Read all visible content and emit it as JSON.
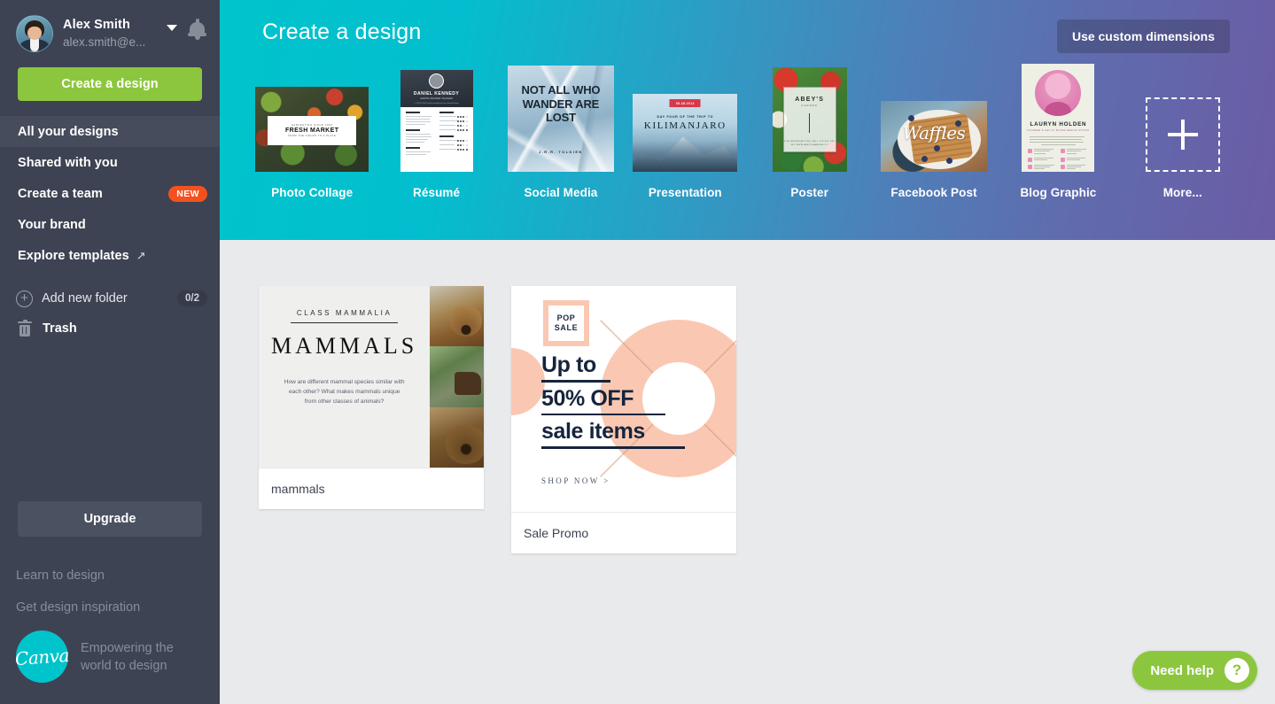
{
  "sidebar": {
    "user": {
      "name": "Alex Smith",
      "email": "alex.smith@e...",
      "avatar_icon": "user-avatar",
      "caret_icon": "chevron-down-icon",
      "bell_icon": "notification-bell-icon"
    },
    "create_button": "Create a design",
    "nav": [
      {
        "label": "All your designs",
        "active": true
      },
      {
        "label": "Shared with you",
        "active": false
      },
      {
        "label": "Create a team",
        "active": false,
        "badge": "NEW"
      },
      {
        "label": "Your brand",
        "active": false
      },
      {
        "label": "Explore templates",
        "active": false,
        "external_icon": "external-link-arrow-icon"
      }
    ],
    "folder": {
      "label": "Add new folder",
      "count": "0/2",
      "icon": "plus-circle-icon"
    },
    "trash": {
      "label": "Trash",
      "icon": "trash-icon"
    },
    "upgrade_button": "Upgrade",
    "footer_links": [
      "Learn to design",
      "Get design inspiration"
    ],
    "brand": {
      "logo_text": "Canva",
      "tagline_line1": "Empowering the",
      "tagline_line2": "world to design"
    }
  },
  "hero": {
    "title": "Create a design",
    "custom_dimensions_button": "Use custom dimensions",
    "tiles": [
      {
        "label": "Photo Collage",
        "type": "collage",
        "t1": "HARVESTING SINCE 1996",
        "t2": "FRESH MARKET",
        "t3": "FROM THE FIELDS TO A PLATE"
      },
      {
        "label": "Résumé",
        "type": "resume",
        "name": "DANIEL KENNEDY",
        "role": "GRAPHIC DESIGNER / MANAGER",
        "contact": "+1 234 567 8900  |  daniel.kennedy@mail.com  |  linkedin/d.kenne"
      },
      {
        "label": "Social Media",
        "type": "social",
        "quote": "NOT ALL WHO WANDER ARE LOST",
        "author": "J.R.R. TOLKIEN"
      },
      {
        "label": "Presentation",
        "type": "presentation",
        "date": "05.28.2014",
        "kicker": "DAY FOUR OF THE TRIP TO",
        "title": "KILIMANJARO"
      },
      {
        "label": "Poster",
        "type": "poster",
        "brand": "ABEY'S",
        "sub": "GARDEN",
        "foot": "FOR RESERVATIONS CALL 718 937 681 382 WWW.ABEYSGARDEN.CO"
      },
      {
        "label": "Facebook Post",
        "type": "facebook",
        "script": "Waffles"
      },
      {
        "label": "Blog Graphic",
        "type": "blog",
        "name": "LAURYN HOLDEN",
        "sub": "FOUNDER & CEO AT BLOOM DESIGN STUDIO"
      },
      {
        "label": "More...",
        "type": "more",
        "icon": "plus-icon"
      }
    ]
  },
  "designs": [
    {
      "title": "mammals",
      "type": "mammals",
      "kicker": "CLASS MAMMALIA",
      "heading": "MAMMALS",
      "body": "How are different mammal species similar with each other? What makes mammals unique from other classes of animals?",
      "photos": [
        "fox",
        "moose",
        "bear"
      ]
    },
    {
      "title": "Sale Promo",
      "type": "sale",
      "badge_line1": "POP",
      "badge_line2": "SALE",
      "line1": "Up to",
      "line2": "50% OFF",
      "line3": "sale items",
      "cta": "SHOP NOW >"
    }
  ],
  "help": {
    "label": "Need help",
    "icon": "question-mark-icon"
  },
  "colors": {
    "sidebar_bg": "#3d4352",
    "sidebar_active": "#464c5b",
    "green": "#8cc63e",
    "teal": "#00c4cc",
    "purple": "#6b5ca5",
    "orange_badge": "#f4511e",
    "content_bg": "#e9eaec"
  }
}
